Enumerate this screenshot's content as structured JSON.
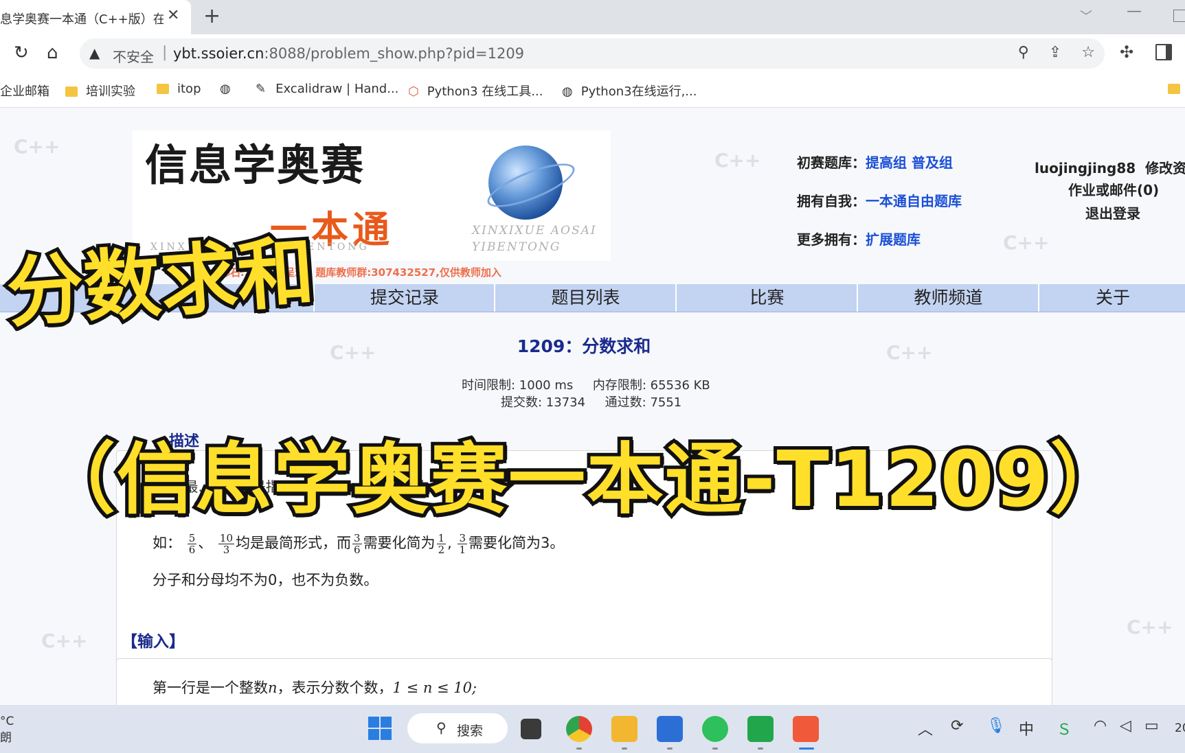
{
  "browser": {
    "tab_title": "息学奥赛一本通（C++版）在线",
    "tab_close": "✕",
    "new_tab": "+",
    "insecure_label": "不安全",
    "url_host": "ybt.ssoier.cn",
    "url_rest": ":8088/problem_show.php?pid=1209",
    "bookmarks": [
      "企业邮箱",
      "培训实验",
      "itop",
      "Excalidraw | Hand...",
      "Python3 在线工具...",
      "Python3在线运行,..."
    ]
  },
  "site": {
    "banner_title": "信息学奥赛",
    "banner_sub": "一本通",
    "pinyin_left": "XINXIXUE AOSAI YIBENTONG",
    "pinyin_right_1": "XINXIXUE AOSAI",
    "pinyin_right_2": "YIBENTONG",
    "banner_note": "都石...长...合呈现。题库教师群:307432527,仅供教师加入",
    "links": {
      "chusai_label": "初赛题库：",
      "chusai_a": "提高组",
      "chusai_b": "普及组",
      "self_label": "拥有自我：",
      "self_link": "一本通自由题库",
      "more_label": "更多拥有：",
      "more_link": "扩展题库"
    },
    "user": {
      "name": "luojingjing88",
      "edit": "修改资料",
      "homework": "作业或邮件(0)",
      "logout": "退出登录"
    },
    "nav": [
      "提交记录",
      "题目列表",
      "比赛",
      "教师频道",
      "关于"
    ]
  },
  "problem": {
    "title": "1209：分数求和",
    "time_limit": "时间限制: 1000 ms",
    "mem_limit": "内存限制: 65536 KB",
    "submits": "提交数: 13734",
    "accepted": "通过数: 7551",
    "desc_head": "描述",
    "desc_line1": "m...最...示。...是指：分子分母...结果的...内",
    "example_prefix": "如：",
    "example_mid": "均是最简形式，而",
    "example_need1": "需要化简为",
    "example_need2": "需要化简为3。",
    "sign_line": "分子和分母均不为0，也不为负数。",
    "input_head": "【输入】",
    "input_line_a": "第一行是一个整数",
    "input_line_b": "，表示分数个数，",
    "input_line_c": "1 ≤ n ≤ 10;"
  },
  "overlay": {
    "caption1": "分数求和",
    "caption2": "（信息学奥赛一本通-T1209）"
  },
  "taskbar": {
    "weather_temp": "°C",
    "weather_text": "朗",
    "search_label": "搜索",
    "clock_fragment": "20"
  },
  "colors": {
    "nav_bg": "#c3d3f2",
    "link_blue": "#1a4fd6",
    "title_navy": "#1a2b8c",
    "caption_yellow": "#ffdf2a"
  }
}
